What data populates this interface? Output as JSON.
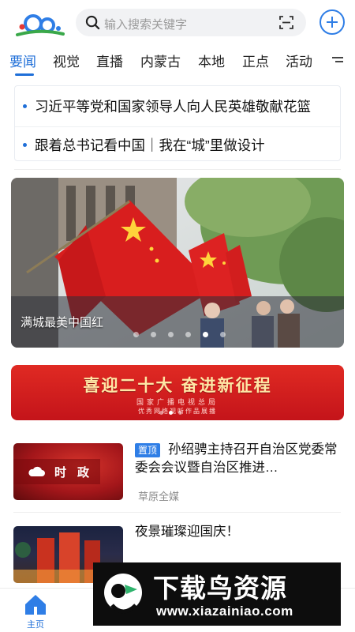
{
  "search": {
    "placeholder": "输入搜索关键字"
  },
  "tabs": [
    {
      "label": "要闻",
      "active": true
    },
    {
      "label": "视觉"
    },
    {
      "label": "直播"
    },
    {
      "label": "内蒙古"
    },
    {
      "label": "本地"
    },
    {
      "label": "正点"
    },
    {
      "label": "活动"
    }
  ],
  "headlines": [
    {
      "text": "习近平等党和国家领导人向人民英雄敬献花篮"
    },
    {
      "text": "跟着总书记看中国｜我在“城”里做设计"
    }
  ],
  "banner": {
    "caption": "满城最美中国红",
    "slide_count": 6,
    "active_slide": 5
  },
  "promo": {
    "title": "喜迎二十大 奋进新征程",
    "subtitle": "国家广播电视总局",
    "subtitle2": "优秀网络视听作品展播"
  },
  "news": [
    {
      "tag": "置顶",
      "title": "孙绍骋主持召开自治区党委常委会会议暨自治区推进…",
      "source": "草原全媒",
      "thumb_label": "时政"
    },
    {
      "title": "夜景璀璨迎国庆！"
    }
  ],
  "watermark": {
    "title": "下载鸟资源",
    "url": "www.xiazainiao.com"
  },
  "bottom_nav": {
    "home_label": "主页"
  },
  "colors": {
    "accent": "#1f6fd8",
    "flag_red": "#d81e1e",
    "promo_red": "#c4141a"
  }
}
